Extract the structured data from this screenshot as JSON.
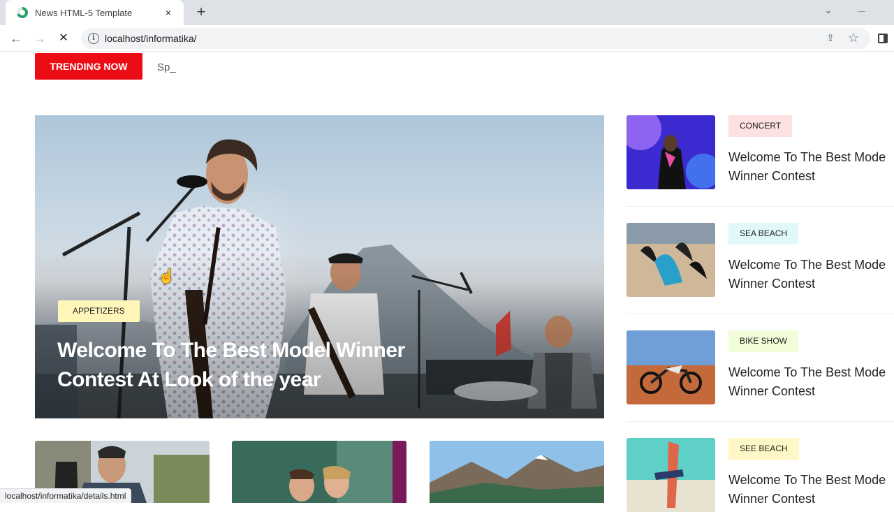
{
  "browser": {
    "tab_title": "News HTML-5 Template",
    "url": "localhost/informatika/",
    "status_url": "localhost/informatika/details.html"
  },
  "icons": {
    "close": "×",
    "new_tab": "+",
    "back": "←",
    "forward": "→",
    "stop": "✕",
    "info": "i",
    "star": "☆",
    "share": "⇪",
    "dropdown": "⌄",
    "hand": "☝"
  },
  "trending": {
    "button": "TRENDING NOW",
    "ticker": "Sp_"
  },
  "hero": {
    "category": "APPETIZERS",
    "title": "Welcome To The Best Model Winner Contest At Look of the year"
  },
  "sidebar": [
    {
      "category": "CONCERT",
      "tag_color": "#fde1e1",
      "title_line1": "Welcome To The Best Mode",
      "title_line2": "Winner Contest"
    },
    {
      "category": "SEA BEACH",
      "tag_color": "#e1f9fb",
      "title_line1": "Welcome To The Best Mode",
      "title_line2": "Winner Contest"
    },
    {
      "category": "BIKE SHOW",
      "tag_color": "#f1fcd9",
      "title_line1": "Welcome To The Best Mode",
      "title_line2": "Winner Contest"
    },
    {
      "category": "SEE BEACH",
      "tag_color": "#fff8c6",
      "title_line1": "Welcome To The Best Mode",
      "title_line2": "Winner Contest"
    }
  ],
  "colors": {
    "accent": "#ec0c15",
    "hero_tag": "#fff7ba"
  }
}
